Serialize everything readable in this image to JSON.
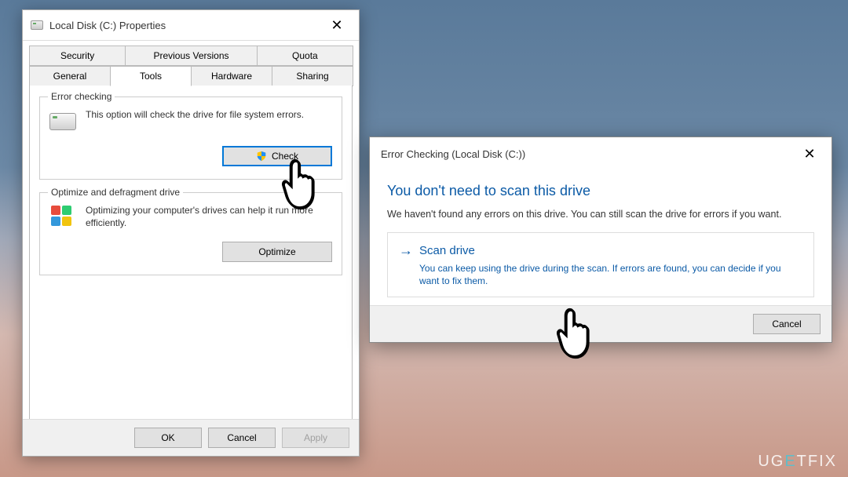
{
  "properties_dialog": {
    "title": "Local Disk (C:) Properties",
    "tabs_row1": [
      "Security",
      "Previous Versions",
      "Quota"
    ],
    "tabs_row2": [
      "General",
      "Tools",
      "Hardware",
      "Sharing"
    ],
    "active_tab": "Tools",
    "error_checking": {
      "label": "Error checking",
      "desc": "This option will check the drive for file system errors.",
      "button": "Check"
    },
    "optimize": {
      "label": "Optimize and defragment drive",
      "desc": "Optimizing your computer's drives can help it run more efficiently.",
      "button": "Optimize"
    },
    "buttons": {
      "ok": "OK",
      "cancel": "Cancel",
      "apply": "Apply"
    }
  },
  "error_dialog": {
    "title": "Error Checking (Local Disk (C:))",
    "heading": "You don't need to scan this drive",
    "desc": "We haven't found any errors on this drive. You can still scan the drive for errors if you want.",
    "scan_option": {
      "title": "Scan drive",
      "subtitle": "You can keep using the drive during the scan. If errors are found, you can decide if you want to fix them."
    },
    "cancel": "Cancel"
  },
  "watermark": "UGETFIX"
}
